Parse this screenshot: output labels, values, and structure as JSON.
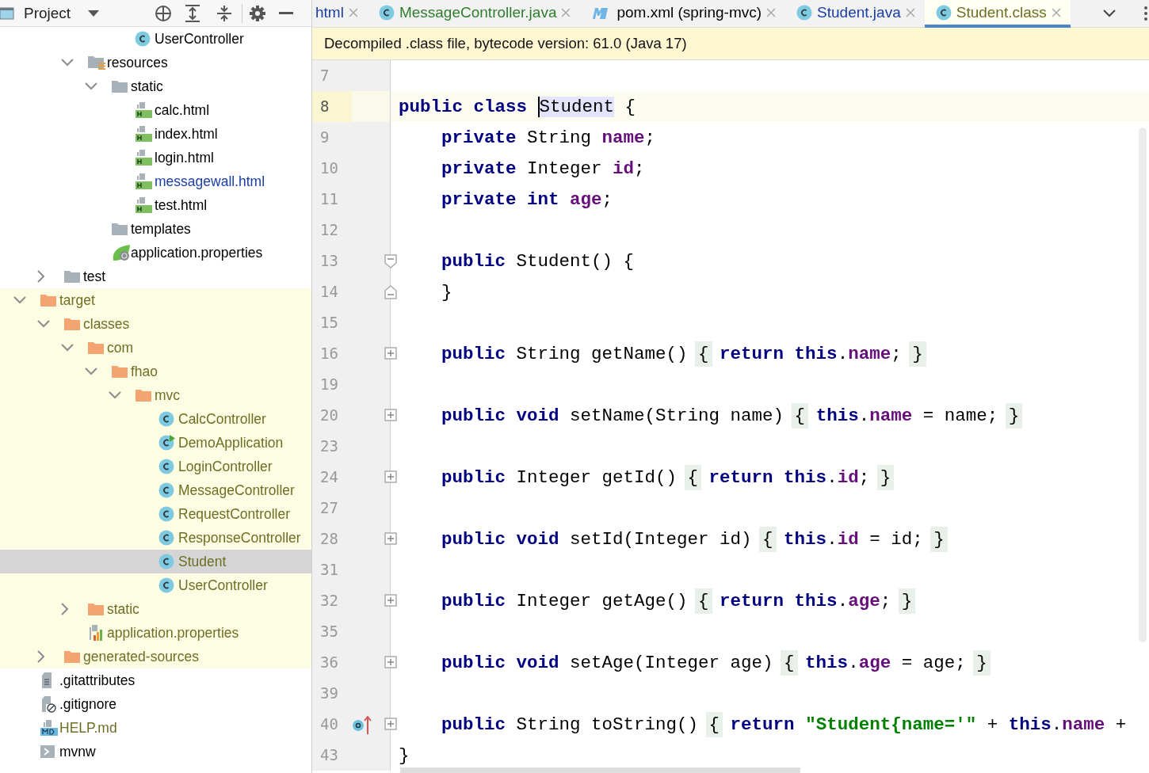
{
  "project_panel": {
    "title": "Project"
  },
  "tree": {
    "items": [
      {
        "children": [
          {
            "children": [
              {
                "children": [
                  {
                    "children": [
                      {
                        "label": "UserController",
                        "kind": "class",
                        "color": "#000000",
                        "selected": false
                      }
                    ]
                  }
                ]
              },
              {
                "label": "resources",
                "kind": "resources",
                "color": "#000000",
                "selected": false,
                "expanded": true,
                "children": [
                  {
                    "label": "static",
                    "kind": "folder",
                    "color": "#000000",
                    "selected": false,
                    "expanded": true,
                    "children": [
                      {
                        "label": "calc.html",
                        "kind": "html",
                        "color": "#000000",
                        "selected": false
                      },
                      {
                        "label": "index.html",
                        "kind": "html",
                        "color": "#000000",
                        "selected": false
                      },
                      {
                        "label": "login.html",
                        "kind": "html",
                        "color": "#000000",
                        "selected": false
                      },
                      {
                        "label": "messagewall.html",
                        "kind": "html",
                        "color": "#1a3ea8",
                        "selected": false
                      },
                      {
                        "label": "test.html",
                        "kind": "html",
                        "color": "#000000",
                        "selected": false
                      }
                    ]
                  },
                  {
                    "label": "templates",
                    "kind": "folder",
                    "color": "#000000",
                    "selected": false
                  },
                  {
                    "label": "application.properties",
                    "kind": "spring",
                    "color": "#000000",
                    "selected": false
                  }
                ]
              }
            ]
          },
          {
            "label": "test",
            "kind": "folder",
            "color": "#000000",
            "selected": false,
            "expanded": false
          }
        ]
      },
      {
        "label": "target",
        "kind": "excluded",
        "color": "#6e6e24",
        "selected": false,
        "excluded": true,
        "expanded": true,
        "children": [
          {
            "label": "classes",
            "kind": "excluded",
            "color": "#6e6e24",
            "selected": false,
            "excluded": true,
            "expanded": true,
            "children": [
              {
                "label": "com",
                "kind": "excluded",
                "color": "#6e6e24",
                "selected": false,
                "excluded": true,
                "expanded": true,
                "children": [
                  {
                    "label": "fhao",
                    "kind": "excluded",
                    "color": "#6e6e24",
                    "selected": false,
                    "excluded": true,
                    "expanded": true,
                    "children": [
                      {
                        "label": "mvc",
                        "kind": "excluded",
                        "color": "#6e6e24",
                        "selected": false,
                        "excluded": true,
                        "expanded": true,
                        "children": [
                          {
                            "label": "CalcController",
                            "kind": "class",
                            "color": "#6e6e24",
                            "selected": false,
                            "excluded": true
                          },
                          {
                            "label": "DemoApplication",
                            "kind": "main",
                            "color": "#6e6e24",
                            "selected": false,
                            "excluded": true
                          },
                          {
                            "label": "LoginController",
                            "kind": "class",
                            "color": "#6e6e24",
                            "selected": false,
                            "excluded": true
                          },
                          {
                            "label": "MessageController",
                            "kind": "class",
                            "color": "#6e6e24",
                            "selected": false,
                            "excluded": true
                          },
                          {
                            "label": "RequestController",
                            "kind": "class",
                            "color": "#6e6e24",
                            "selected": false,
                            "excluded": true
                          },
                          {
                            "label": "ResponseController",
                            "kind": "class",
                            "color": "#6e6e24",
                            "selected": false,
                            "excluded": true
                          },
                          {
                            "label": "Student",
                            "kind": "class",
                            "color": "#6e6e24",
                            "selected": true,
                            "excluded": true
                          },
                          {
                            "label": "UserController",
                            "kind": "class",
                            "color": "#6e6e24",
                            "selected": false,
                            "excluded": true
                          }
                        ]
                      }
                    ]
                  }
                ]
              },
              {
                "label": "static",
                "kind": "excluded",
                "color": "#6e6e24",
                "selected": false,
                "excluded": true,
                "expanded": false
              },
              {
                "label": "application.properties",
                "kind": "properties",
                "color": "#6e6e24",
                "selected": false,
                "excluded": true
              }
            ]
          },
          {
            "label": "generated-sources",
            "kind": "excluded",
            "color": "#6e6e24",
            "selected": false,
            "excluded": true,
            "expanded": false
          }
        ]
      },
      {
        "label": ".gitattributes",
        "kind": "text",
        "color": "#000000",
        "selected": false
      },
      {
        "label": ".gitignore",
        "kind": "ignore",
        "color": "#000000",
        "selected": false
      },
      {
        "label": "HELP.md",
        "kind": "markdown",
        "color": "#6e6e24",
        "selected": false
      },
      {
        "label": "mvnw",
        "kind": "shell",
        "color": "#000000",
        "selected": false
      }
    ]
  },
  "tabs": [
    {
      "label": "html",
      "kind": "plain",
      "color": "#1a3ea8",
      "selected": false
    },
    {
      "label": "MessageController.java",
      "kind": "class",
      "color": "#2f7d2f",
      "selected": false
    },
    {
      "label": "pom.xml (spring-mvc)",
      "kind": "maven",
      "color": "#000000",
      "selected": false
    },
    {
      "label": "Student.java",
      "kind": "class",
      "color": "#1a3ea8",
      "selected": false
    },
    {
      "label": "Student.class",
      "kind": "class",
      "color": "#6e6e24",
      "selected": true
    }
  ],
  "banner": {
    "text": "Decompiled .class file, bytecode version: 61.0 (Java 17)"
  },
  "code": {
    "lines": [
      {
        "number": "7",
        "current": false,
        "overrides": false
      },
      {
        "number": "8",
        "current": true,
        "overrides": false,
        "tokens": [
          {
            "text": "public class ",
            "kind": "kw"
          },
          {
            "text": "Student",
            "kind": "usage"
          },
          {
            "text": " {",
            "kind": "plain"
          }
        ]
      },
      {
        "number": "9",
        "current": false,
        "overrides": false,
        "tokens": [
          {
            "text": "    private",
            "kind": "kw"
          },
          {
            "text": " String ",
            "kind": "plain"
          },
          {
            "text": "name",
            "kind": "field"
          },
          {
            "text": ";",
            "kind": "plain"
          }
        ]
      },
      {
        "number": "10",
        "current": false,
        "overrides": false,
        "tokens": [
          {
            "text": "    private",
            "kind": "kw"
          },
          {
            "text": " Integer ",
            "kind": "plain"
          },
          {
            "text": "id",
            "kind": "field"
          },
          {
            "text": ";",
            "kind": "plain"
          }
        ]
      },
      {
        "number": "11",
        "current": false,
        "overrides": false,
        "tokens": [
          {
            "text": "    private int ",
            "kind": "kw"
          },
          {
            "text": "age",
            "kind": "field"
          },
          {
            "text": ";",
            "kind": "plain"
          }
        ]
      },
      {
        "number": "12",
        "current": false,
        "overrides": false
      },
      {
        "number": "13",
        "kind": "opener",
        "current": false,
        "overrides": false,
        "tokens": [
          {
            "text": "    public",
            "kind": "kw"
          },
          {
            "text": " Student() {",
            "kind": "plain"
          }
        ]
      },
      {
        "number": "14",
        "kind": "closer",
        "current": false,
        "overrides": false,
        "tokens": [
          {
            "text": "    }",
            "kind": "plain"
          }
        ]
      },
      {
        "number": "15",
        "current": false,
        "overrides": false
      },
      {
        "number": "16",
        "kind": "folded",
        "current": false,
        "overrides": false,
        "tokens": [
          {
            "text": "    public",
            "kind": "kw"
          },
          {
            "text": " String getName() ",
            "kind": "plain"
          },
          {
            "text": "{",
            "kind": "brace"
          },
          {
            "text": " return this",
            "kind": "kw"
          },
          {
            "text": ".",
            "kind": "plain"
          },
          {
            "text": "name",
            "kind": "field"
          },
          {
            "text": "; ",
            "kind": "plain"
          },
          {
            "text": "}",
            "kind": "brace"
          }
        ]
      },
      {
        "number": "19",
        "current": false,
        "overrides": false
      },
      {
        "number": "20",
        "kind": "folded",
        "current": false,
        "overrides": false,
        "tokens": [
          {
            "text": "    public void",
            "kind": "kw"
          },
          {
            "text": " setName(String name) ",
            "kind": "plain"
          },
          {
            "text": "{",
            "kind": "brace"
          },
          {
            "text": " this",
            "kind": "kw"
          },
          {
            "text": ".",
            "kind": "plain"
          },
          {
            "text": "name",
            "kind": "field"
          },
          {
            "text": " = name; ",
            "kind": "plain"
          },
          {
            "text": "}",
            "kind": "brace"
          }
        ]
      },
      {
        "number": "23",
        "current": false,
        "overrides": false
      },
      {
        "number": "24",
        "kind": "folded",
        "current": false,
        "overrides": false,
        "tokens": [
          {
            "text": "    public",
            "kind": "kw"
          },
          {
            "text": " Integer getId() ",
            "kind": "plain"
          },
          {
            "text": "{",
            "kind": "brace"
          },
          {
            "text": " return this",
            "kind": "kw"
          },
          {
            "text": ".",
            "kind": "plain"
          },
          {
            "text": "id",
            "kind": "field"
          },
          {
            "text": "; ",
            "kind": "plain"
          },
          {
            "text": "}",
            "kind": "brace"
          }
        ]
      },
      {
        "number": "27",
        "current": false,
        "overrides": false
      },
      {
        "number": "28",
        "kind": "folded",
        "current": false,
        "overrides": false,
        "tokens": [
          {
            "text": "    public void",
            "kind": "kw"
          },
          {
            "text": " setId(Integer id) ",
            "kind": "plain"
          },
          {
            "text": "{",
            "kind": "brace"
          },
          {
            "text": " this",
            "kind": "kw"
          },
          {
            "text": ".",
            "kind": "plain"
          },
          {
            "text": "id",
            "kind": "field"
          },
          {
            "text": " = id; ",
            "kind": "plain"
          },
          {
            "text": "}",
            "kind": "brace"
          }
        ]
      },
      {
        "number": "31",
        "current": false,
        "overrides": false
      },
      {
        "number": "32",
        "kind": "folded",
        "current": false,
        "overrides": false,
        "tokens": [
          {
            "text": "    public",
            "kind": "kw"
          },
          {
            "text": " Integer getAge() ",
            "kind": "plain"
          },
          {
            "text": "{",
            "kind": "brace"
          },
          {
            "text": " return this",
            "kind": "kw"
          },
          {
            "text": ".",
            "kind": "plain"
          },
          {
            "text": "age",
            "kind": "field"
          },
          {
            "text": "; ",
            "kind": "plain"
          },
          {
            "text": "}",
            "kind": "brace"
          }
        ]
      },
      {
        "number": "35",
        "current": false,
        "overrides": false
      },
      {
        "number": "36",
        "kind": "folded",
        "current": false,
        "overrides": false,
        "tokens": [
          {
            "text": "    public void",
            "kind": "kw"
          },
          {
            "text": " setAge(Integer age) ",
            "kind": "plain"
          },
          {
            "text": "{",
            "kind": "brace"
          },
          {
            "text": " this",
            "kind": "kw"
          },
          {
            "text": ".",
            "kind": "plain"
          },
          {
            "text": "age",
            "kind": "field"
          },
          {
            "text": " = age; ",
            "kind": "plain"
          },
          {
            "text": "}",
            "kind": "brace"
          }
        ]
      },
      {
        "number": "39",
        "current": false,
        "overrides": false
      },
      {
        "number": "40",
        "kind": "folded",
        "current": false,
        "overrides": true,
        "tokens": [
          {
            "text": "    public",
            "kind": "kw"
          },
          {
            "text": " String toString() ",
            "kind": "plain"
          },
          {
            "text": "{",
            "kind": "brace"
          },
          {
            "text": " return ",
            "kind": "kw"
          },
          {
            "text": "\"Student{name='\"",
            "kind": "str"
          },
          {
            "text": " + ",
            "kind": "plain"
          },
          {
            "text": "this",
            "kind": "kw"
          },
          {
            "text": ".",
            "kind": "plain"
          },
          {
            "text": "name",
            "kind": "field"
          },
          {
            "text": " +",
            "kind": "plain"
          }
        ]
      },
      {
        "number": "43",
        "current": false,
        "overrides": false,
        "tokens": [
          {
            "text": "}",
            "kind": "plain"
          }
        ]
      }
    ]
  }
}
